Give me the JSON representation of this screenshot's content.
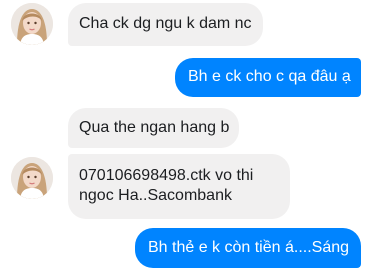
{
  "messages": [
    {
      "sender": "contact",
      "text": "Cha ck dg ngu k dam nc"
    },
    {
      "sender": "me",
      "text": "Bh e ck cho c qa đâu ạ"
    },
    {
      "sender": "contact",
      "text": "Qua the ngan hang b"
    },
    {
      "sender": "contact",
      "text": "070106698498.ctk vo thi ngoc Ha..Sacombank"
    },
    {
      "sender": "me",
      "text": "Bh thẻ e k còn tiền á....Sáng"
    }
  ],
  "colors": {
    "incoming_bubble": "#f1f0f0",
    "outgoing_bubble": "#0084ff",
    "incoming_text": "#1c1e21",
    "outgoing_text": "#ffffff"
  },
  "icons": {
    "contact_avatar": "profile-photo"
  }
}
